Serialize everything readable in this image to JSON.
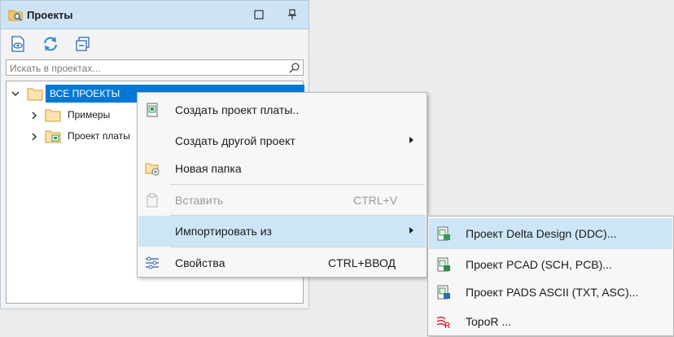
{
  "panel": {
    "title": "Проекты",
    "search_placeholder": "Искать в проектах..."
  },
  "tree": {
    "items": [
      {
        "label": "ВСЕ ПРОЕКТЫ"
      },
      {
        "label": "Примеры"
      },
      {
        "label": "Проект платы"
      }
    ]
  },
  "context_menu": {
    "items": [
      {
        "label": "Создать проект платы..",
        "shortcut": ""
      },
      {
        "label": "Создать другой проект",
        "shortcut": ""
      },
      {
        "label": "Новая папка",
        "shortcut": ""
      },
      {
        "label": "Вставить",
        "shortcut": "CTRL+V"
      },
      {
        "label": "Импортировать из",
        "shortcut": ""
      },
      {
        "label": "Свойства",
        "shortcut": "CTRL+ВВОД"
      }
    ]
  },
  "submenu": {
    "items": [
      {
        "label": "Проект Delta Design (DDC)..."
      },
      {
        "label": "Проект PCAD (SCH, PCB)..."
      },
      {
        "label": "Проект PADS ASCII (TXT, ASC)..."
      },
      {
        "label": "TopoR ..."
      }
    ]
  },
  "colors": {
    "accent": "#0078d7",
    "highlight": "#cde6f7",
    "header": "#cfe3f7"
  }
}
